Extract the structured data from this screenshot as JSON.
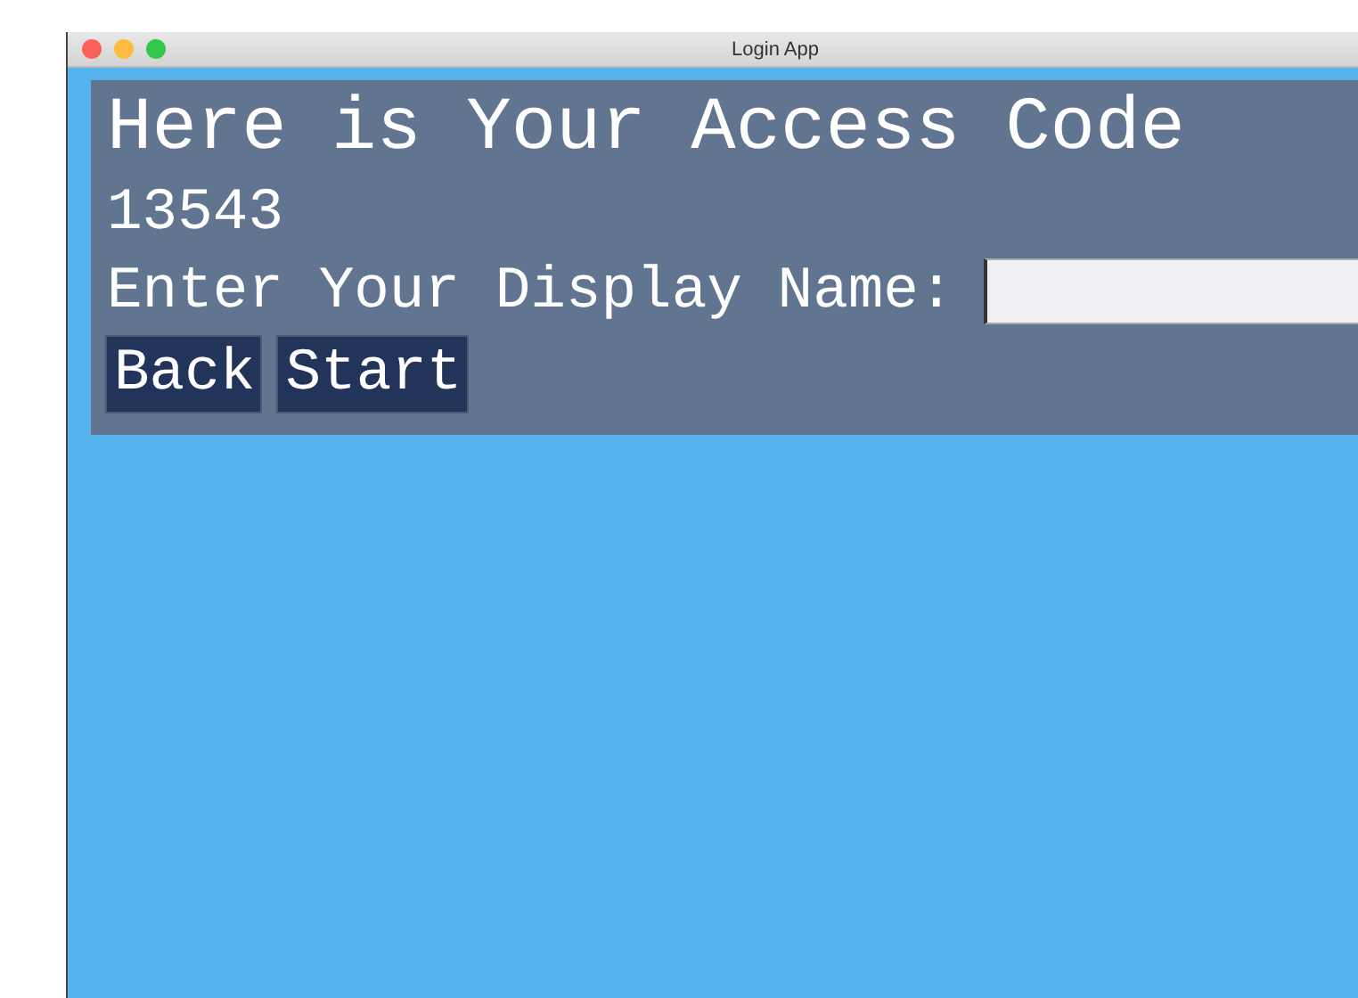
{
  "window": {
    "title": "Login App"
  },
  "heading": "Here is Your Access Code",
  "access_code": "13543",
  "display_name": {
    "label": "Enter Your Display Name:"
  },
  "buttons": [
    "Back",
    "Start"
  ]
}
